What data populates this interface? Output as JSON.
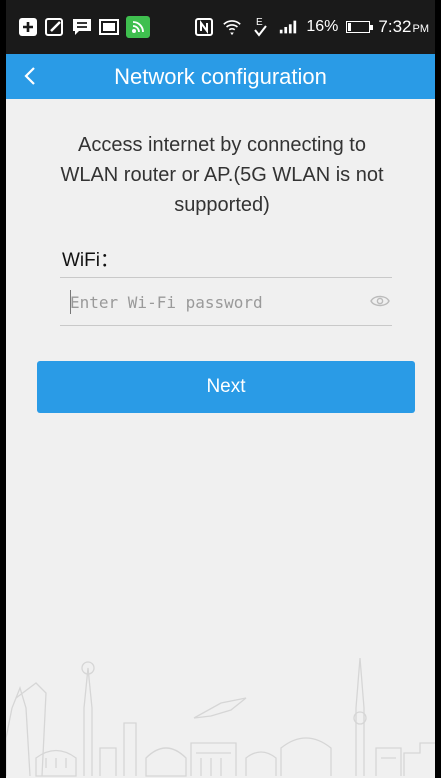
{
  "status_bar": {
    "signal_label": "E",
    "battery": "16%",
    "battery_level": 0.16,
    "time": "7:32",
    "ampm": "PM"
  },
  "header": {
    "title": "Network configuration"
  },
  "main": {
    "intro": "Access internet by connecting to WLAN router or AP.(5G WLAN is not supported)",
    "wifi_label": "WiFi：",
    "password_placeholder": "Enter Wi-Fi password",
    "password_value": "",
    "next_label": "Next"
  },
  "colors": {
    "accent": "#2a9be6",
    "status_bar_bg": "#1a1a1a",
    "page_bg": "#f0f0f0"
  },
  "icons": [
    "add-icon",
    "edit-icon",
    "chat-icon",
    "gallery-icon",
    "wifi-share-icon",
    "nfc-icon",
    "wifi-icon",
    "data-signal-icon",
    "cell-signal-icon",
    "battery-icon",
    "back-icon",
    "eye-icon"
  ]
}
